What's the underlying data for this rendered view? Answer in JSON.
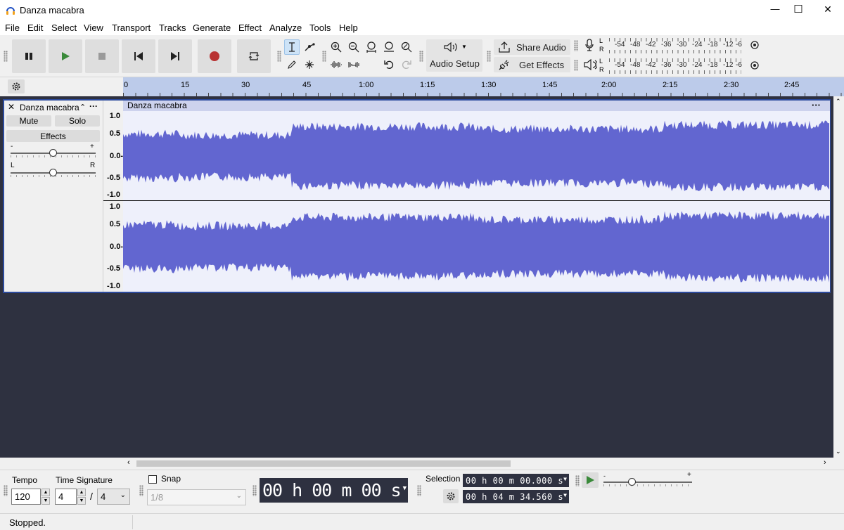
{
  "window": {
    "title": "Danza macabra",
    "minimize": "—",
    "maximize": "☐",
    "close": "✕"
  },
  "menu": [
    "File",
    "Edit",
    "Select",
    "View",
    "Transport",
    "Tracks",
    "Generate",
    "Effect",
    "Analyze",
    "Tools",
    "Help"
  ],
  "toolbar": {
    "audio_setup": "Audio Setup",
    "share_audio": "Share Audio",
    "get_effects": "Get Effects"
  },
  "meters": {
    "record_scale": [
      "-54",
      "-48",
      "-42",
      "-36",
      "-30",
      "-24",
      "-18",
      "-12",
      "-6"
    ],
    "playback_scale": [
      "-54",
      "-48",
      "-42",
      "-36",
      "-30",
      "-24",
      "-18",
      "-12",
      "-6"
    ],
    "channel_l": "L",
    "channel_r": "R"
  },
  "ruler": {
    "ticks": [
      "0",
      "15",
      "30",
      "45",
      "1:00",
      "1:15",
      "1:30",
      "1:45",
      "2:00",
      "2:15",
      "2:30",
      "2:45"
    ]
  },
  "track": {
    "name": "Danza macabra",
    "close": "✕",
    "collapse": "⌃",
    "menu": "···",
    "mute": "Mute",
    "solo": "Solo",
    "effects": "Effects",
    "gain_minus": "-",
    "gain_plus": "+",
    "pan_left": "L",
    "pan_right": "R",
    "clip_name": "Danza macabra",
    "clip_menu": "···",
    "vruler_top": [
      "1.0",
      "0.5",
      "0.0-",
      "-0.5",
      "-1.0"
    ],
    "vruler_bottom": [
      "1.0",
      "0.5",
      "0.0-",
      "-0.5",
      "-1.0"
    ]
  },
  "bottom": {
    "tempo_label": "Tempo",
    "tempo_value": "120",
    "time_sig_label": "Time Signature",
    "time_sig_num": "4",
    "time_sig_slash": "/",
    "time_sig_den": "4",
    "snap_label": "Snap",
    "snap_value": "1/8",
    "time_display": "00 h 00 m 00 s",
    "selection_label": "Selection",
    "selection_start": "00 h 00 m 00.000 s",
    "selection_end": "00 h 04 m 34.560 s"
  },
  "status": {
    "text": "Stopped."
  },
  "colors": {
    "waveform": "#6266d0",
    "clip_bg": "#eef0fb",
    "clip_header": "#cdd2ed",
    "ruler": "#bccbea",
    "track_area": "#2e3140",
    "record": "#c0392b",
    "play": "#3a8a3a"
  }
}
